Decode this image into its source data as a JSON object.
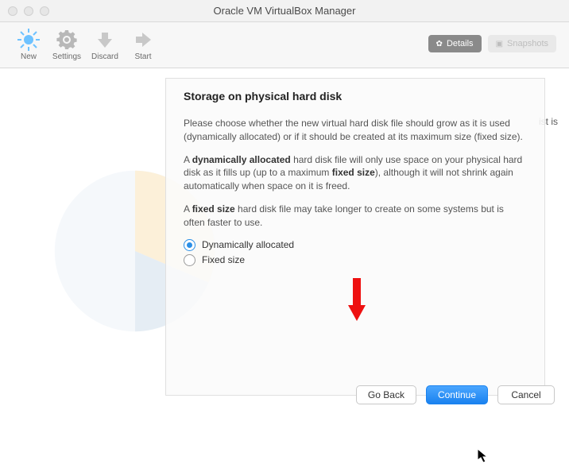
{
  "window": {
    "title": "Oracle VM VirtualBox Manager"
  },
  "toolbar": {
    "new": "New",
    "settings": "Settings",
    "discard": "Discard",
    "start": "Start",
    "details": "Details",
    "snapshots": "Snapshots"
  },
  "side": {
    "label_fragment": "ist is"
  },
  "dialog": {
    "heading": "Storage on physical hard disk",
    "para1": "Please choose whether the new virtual hard disk file should grow as it is used (dynamically allocated) or if it should be created at its maximum size (fixed size).",
    "para2_a": "A ",
    "para2_b": "dynamically allocated",
    "para2_c": " hard disk file will only use space on your physical hard disk as it fills up (up to a maximum ",
    "para2_d": "fixed size",
    "para2_e": "), although it will not shrink again automatically when space on it is freed.",
    "para3_a": "A ",
    "para3_b": "fixed size",
    "para3_c": " hard disk file may take longer to create on some systems but is often faster to use.",
    "radio_dynamic": "Dynamically allocated",
    "radio_fixed": "Fixed size",
    "btn_goback": "Go Back",
    "btn_continue": "Continue",
    "btn_cancel": "Cancel"
  }
}
